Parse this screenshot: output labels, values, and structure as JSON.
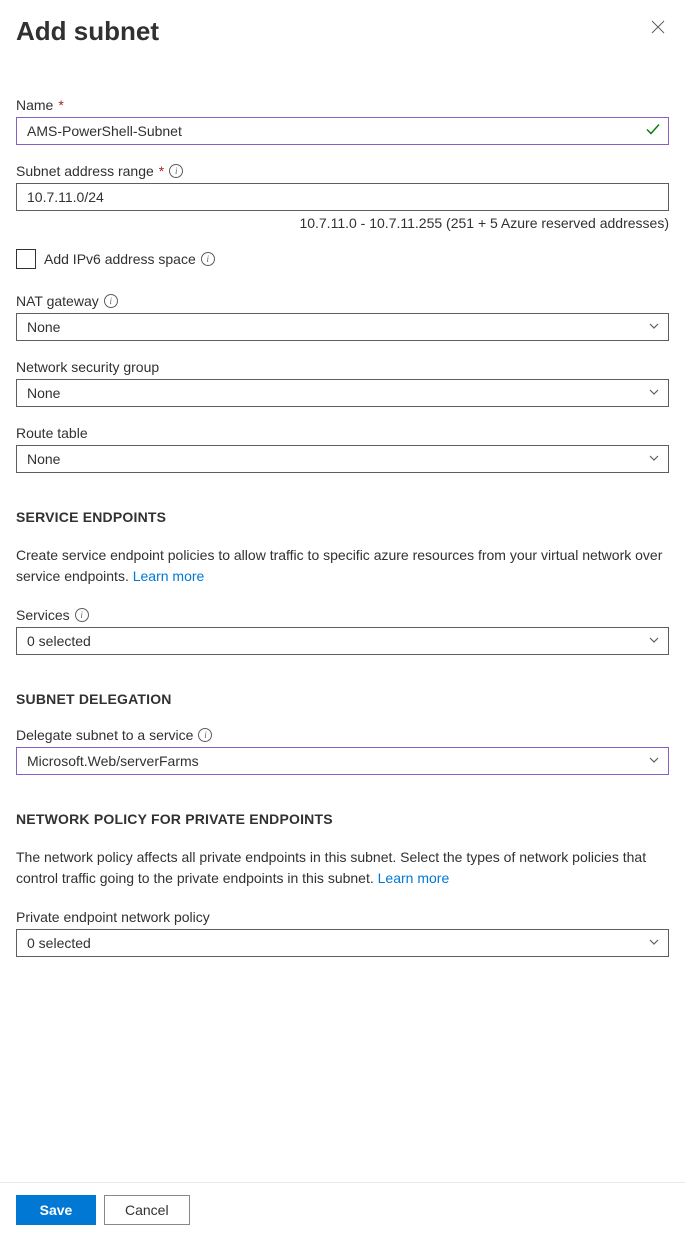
{
  "header": {
    "title": "Add subnet"
  },
  "fields": {
    "name": {
      "label": "Name",
      "value": "AMS-PowerShell-Subnet"
    },
    "address_range": {
      "label": "Subnet address range",
      "value": "10.7.11.0/24",
      "helper": "10.7.11.0 - 10.7.11.255 (251 + 5 Azure reserved addresses)"
    },
    "ipv6": {
      "label": "Add IPv6 address space"
    },
    "nat_gateway": {
      "label": "NAT gateway",
      "value": "None"
    },
    "nsg": {
      "label": "Network security group",
      "value": "None"
    },
    "route_table": {
      "label": "Route table",
      "value": "None"
    }
  },
  "sections": {
    "service_endpoints": {
      "heading": "SERVICE ENDPOINTS",
      "description": "Create service endpoint policies to allow traffic to specific azure resources from your virtual network over service endpoints. ",
      "learn_more": "Learn more",
      "services_label": "Services",
      "services_value": "0 selected"
    },
    "subnet_delegation": {
      "heading": "SUBNET DELEGATION",
      "delegate_label": "Delegate subnet to a service",
      "delegate_value": "Microsoft.Web/serverFarms"
    },
    "network_policy": {
      "heading": "NETWORK POLICY FOR PRIVATE ENDPOINTS",
      "description": "The network policy affects all private endpoints in this subnet. Select the types of network policies that control traffic going to the private endpoints in this subnet. ",
      "learn_more": "Learn more",
      "policy_label": "Private endpoint network policy",
      "policy_value": "0 selected"
    }
  },
  "footer": {
    "save": "Save",
    "cancel": "Cancel"
  }
}
